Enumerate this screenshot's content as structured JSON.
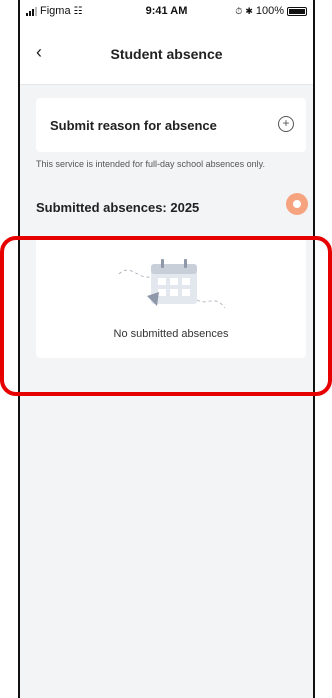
{
  "status_bar": {
    "carrier": "Figma",
    "time": "9:41 AM",
    "battery": "100%",
    "icons": [
      "signal-icon",
      "wifi-icon",
      "alarm-icon",
      "bluetooth-icon",
      "battery-icon"
    ]
  },
  "nav": {
    "back_icon": "chevron-left-icon",
    "title": "Student absence"
  },
  "submit_card": {
    "label": "Submit reason for absence",
    "icon": "plus-circle-icon"
  },
  "notice": "This service is intended for full-day school absences only.",
  "submitted": {
    "title": "Submitted absences: 2025",
    "group_icon": "group-icon",
    "toggle_icon": "chevron-up-icon",
    "empty_icon": "calendar-icon",
    "empty_text": "No submitted absences"
  },
  "colors": {
    "accent": "#F6A37F",
    "highlight": "#E60000",
    "page_background": "#F3F4F6"
  }
}
